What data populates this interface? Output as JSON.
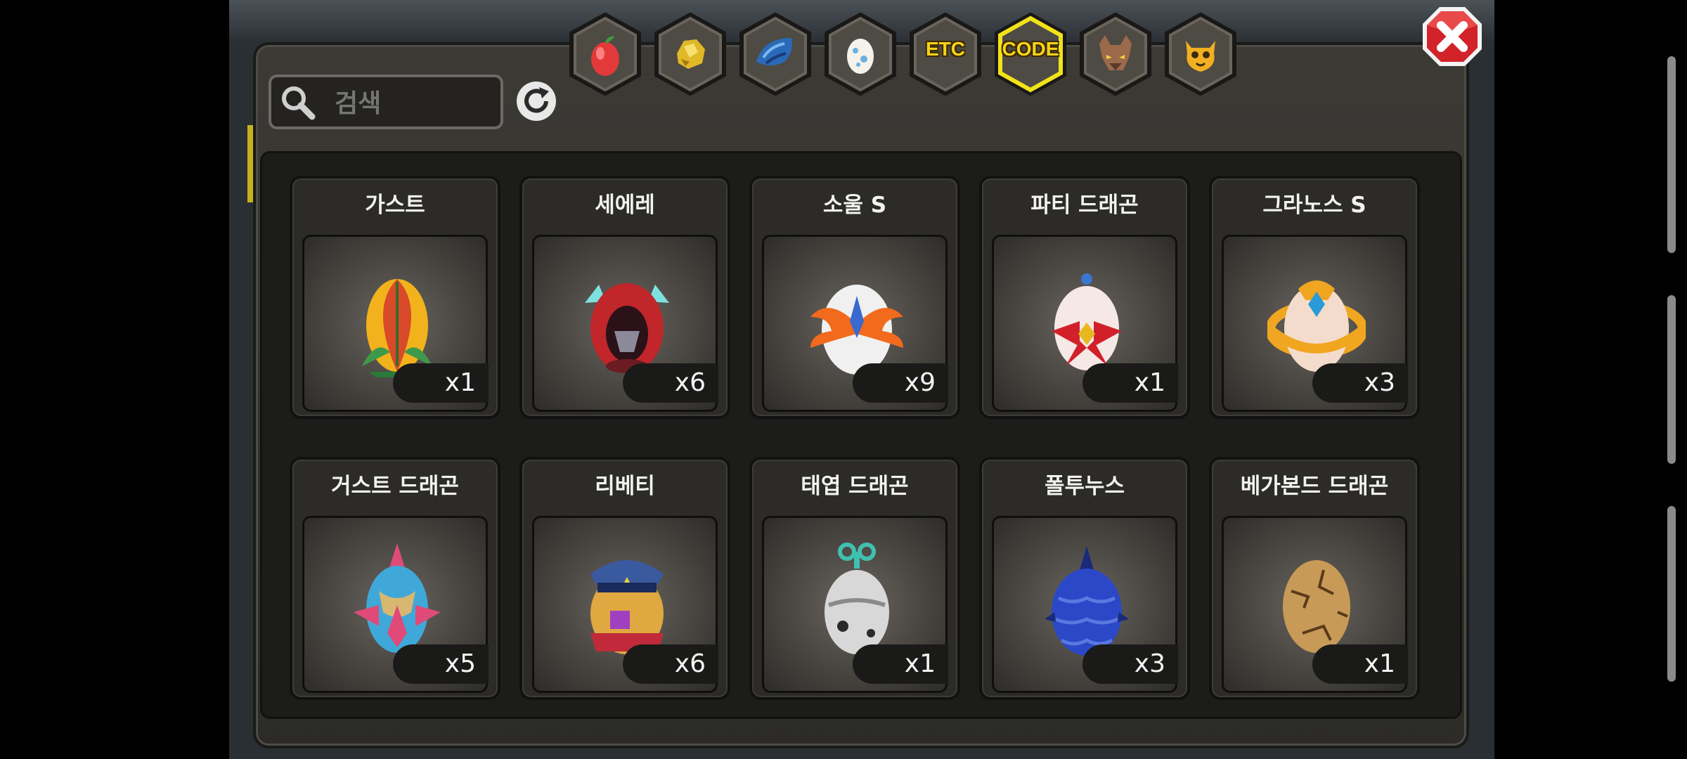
{
  "search": {
    "placeholder": "검색"
  },
  "tabs": [
    {
      "name": "fruit",
      "label": "",
      "icon": "red-fruit-icon",
      "active": false
    },
    {
      "name": "gold",
      "label": "",
      "icon": "gold-ore-icon",
      "active": false
    },
    {
      "name": "scale",
      "label": "",
      "icon": "blue-scale-icon",
      "active": false
    },
    {
      "name": "egg",
      "label": "",
      "icon": "egg-icon",
      "active": false
    },
    {
      "name": "etc",
      "label": "ETC",
      "icon": "",
      "active": false
    },
    {
      "name": "code",
      "label": "CODE",
      "icon": "",
      "active": true
    },
    {
      "name": "beast",
      "label": "",
      "icon": "werewolf-icon",
      "active": false
    },
    {
      "name": "imp",
      "label": "",
      "icon": "horned-cat-icon",
      "active": false
    }
  ],
  "items": [
    {
      "name": "가스트",
      "qty": "x1",
      "icon": "leaf-egg-icon",
      "colors": [
        "#d84a2a",
        "#f2b21c",
        "#3e9a4a"
      ]
    },
    {
      "name": "세에레",
      "qty": "x6",
      "icon": "red-hood-egg-icon",
      "colors": [
        "#c0262a",
        "#6a1c22",
        "#7fe0e0"
      ]
    },
    {
      "name": "소울 S",
      "qty": "x9",
      "icon": "winged-white-egg-icon",
      "colors": [
        "#f0f0f0",
        "#f26a1c",
        "#3a6ad0"
      ]
    },
    {
      "name": "파티 드래곤",
      "qty": "x1",
      "icon": "ribbon-egg-icon",
      "colors": [
        "#f6e8e4",
        "#d2202a",
        "#e8b820"
      ]
    },
    {
      "name": "그라노스 S",
      "qty": "x3",
      "icon": "gold-ring-egg-icon",
      "colors": [
        "#f4dccc",
        "#f0a620",
        "#2a9ad8"
      ]
    },
    {
      "name": "거스트 드래곤",
      "qty": "x5",
      "icon": "spiked-tribal-egg-icon",
      "colors": [
        "#40a8d8",
        "#e04a78",
        "#d8b870"
      ]
    },
    {
      "name": "리베티",
      "qty": "x6",
      "icon": "captain-egg-icon",
      "colors": [
        "#e0a840",
        "#3a5aa0",
        "#c02a3a"
      ]
    },
    {
      "name": "태엽 드래곤",
      "qty": "x1",
      "icon": "windup-egg-icon",
      "colors": [
        "#d8d8d8",
        "#8a8a8a",
        "#40c0b0"
      ]
    },
    {
      "name": "폴투누스",
      "qty": "x3",
      "icon": "blue-scale-egg-icon",
      "colors": [
        "#2a48c8",
        "#1a2a7a",
        "#5a78e0"
      ]
    },
    {
      "name": "베가본드 드래곤",
      "qty": "x1",
      "icon": "cracked-brown-egg-icon",
      "colors": [
        "#c89a58",
        "#9a6a30",
        "#5a3a18"
      ]
    }
  ],
  "accent": {
    "active_tab_border": "#f2e21a",
    "close_button": "#d2222a",
    "tab_text": "#f7d21a"
  }
}
